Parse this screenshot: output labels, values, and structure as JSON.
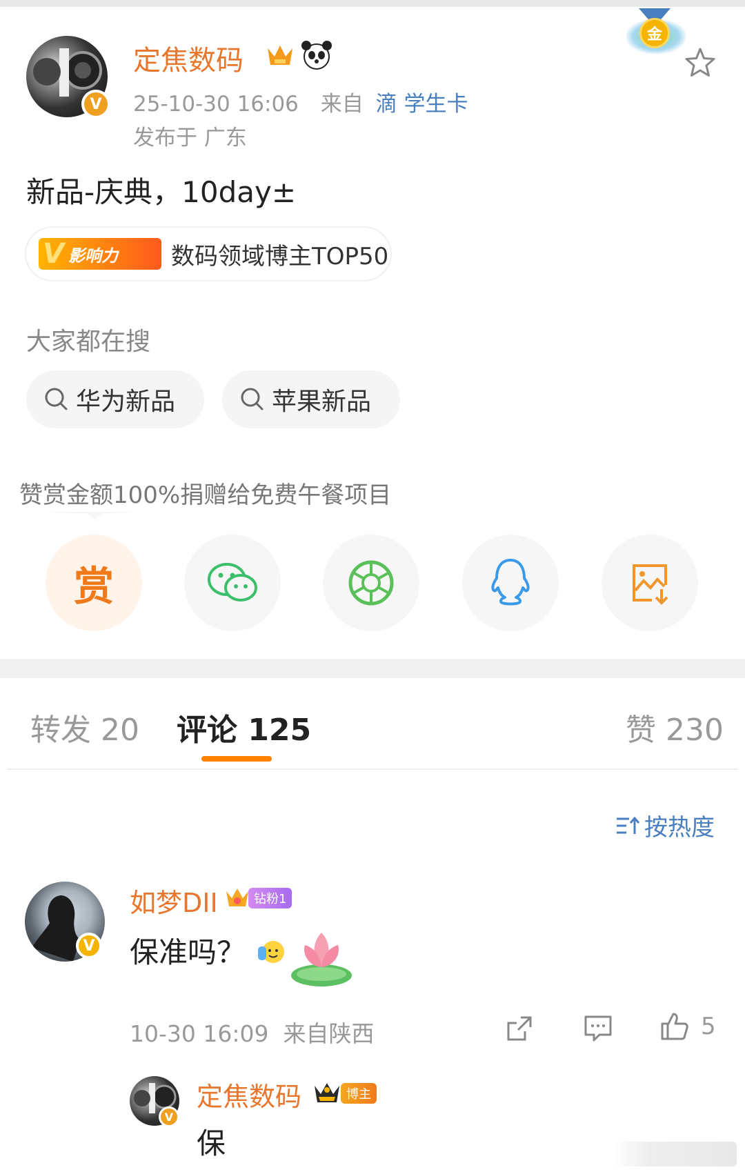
{
  "post": {
    "author": "定焦数码",
    "timestamp": "25-10-30 16:06",
    "source_prefix": "来自",
    "source_device": "滴 学生卡",
    "location": "发布于 广东",
    "content": "新品-庆典，10day±",
    "influence_label": "影响力",
    "influence_text": "数码领域博主TOP50",
    "medal_text": "金"
  },
  "searches": {
    "heading": "大家都在搜",
    "items": [
      "华为新品",
      "苹果新品"
    ]
  },
  "reward": {
    "caption": "赞赏金额100%捐赠给免费午餐项目",
    "reward_label": "赏"
  },
  "share_icons": [
    "reward-icon",
    "wechat-icon",
    "moments-icon",
    "qq-icon",
    "save-image-icon"
  ],
  "tabs": {
    "repost": "转发 20",
    "comment": "评论 125",
    "like": "赞 230"
  },
  "sort": {
    "label": "按热度"
  },
  "comment": {
    "author": "如梦DII",
    "badge": "钻粉1",
    "text": "保准吗？",
    "meta": "10-30 16:09  来自陕西",
    "likes": "5"
  },
  "reply": {
    "author": "定焦数码",
    "badge": "博主",
    "text": "保"
  },
  "colors": {
    "accent_orange": "#ff8200",
    "name_orange": "#e8772e",
    "link_blue": "#4a7fbf",
    "wechat_green": "#3bbf6a",
    "qq_blue": "#3a9ae8"
  }
}
